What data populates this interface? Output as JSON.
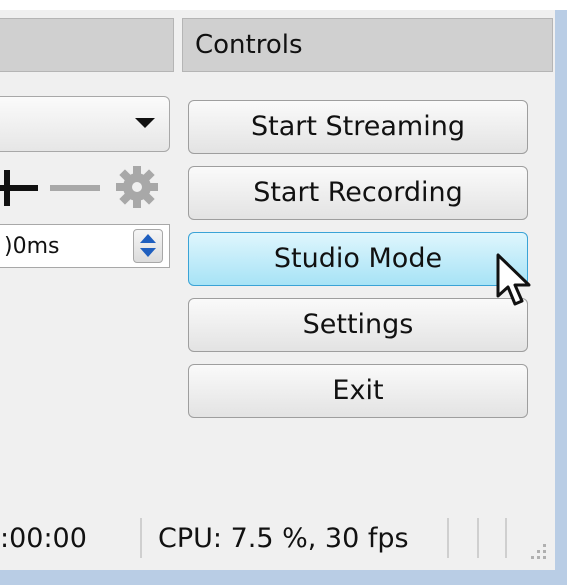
{
  "controls": {
    "header": "Controls",
    "buttons": [
      {
        "label": "Start Streaming"
      },
      {
        "label": "Start Recording"
      },
      {
        "label": "Studio Mode"
      },
      {
        "label": "Settings"
      },
      {
        "label": "Exit"
      }
    ]
  },
  "left_panel": {
    "spinbox_value": ")0ms"
  },
  "status_bar": {
    "time": ":00:00",
    "cpu": "CPU: 7.5 %, 30 fps"
  },
  "icons": {
    "dropdown_arrow": "chevron-down-icon",
    "add": "plus-icon",
    "remove": "minus-icon",
    "settings": "gear-icon",
    "spin_up": "arrow-up-icon",
    "spin_down": "arrow-down-icon",
    "cursor": "mouse-cursor-icon",
    "resize": "resize-grip-icon"
  },
  "colors": {
    "active_button": "#a7e3f6",
    "spin_arrow": "#1f5fbf",
    "window_border": "#b9cde5"
  }
}
